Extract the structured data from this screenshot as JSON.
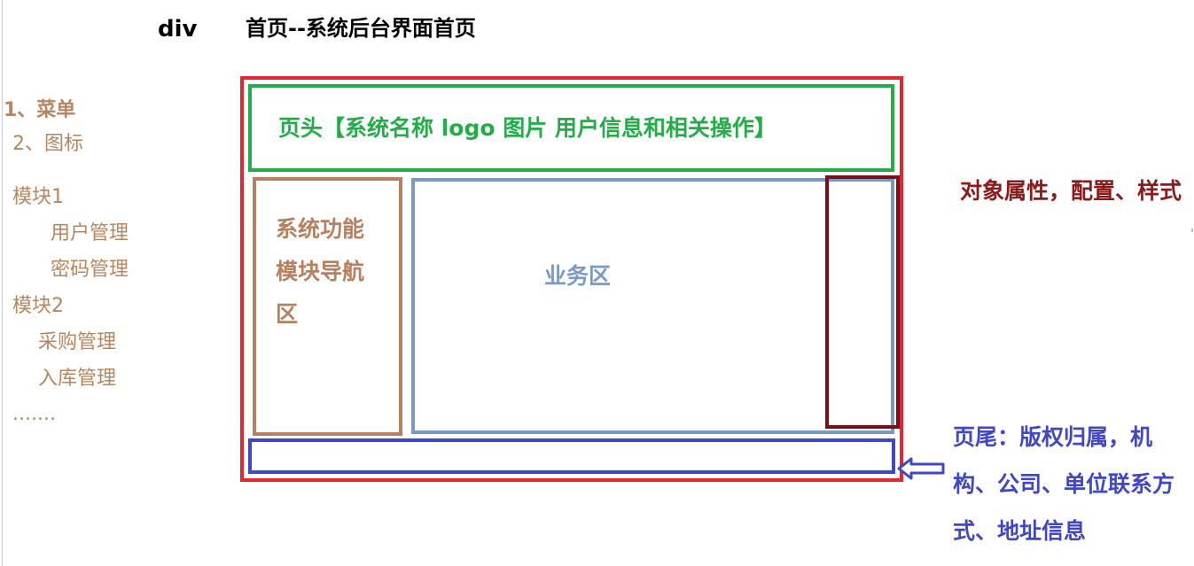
{
  "title": {
    "div_label": "div",
    "page_title": "首页--系统后台界面首页"
  },
  "menu": {
    "items": [
      {
        "label": "1、菜单",
        "bold": true
      },
      {
        "label": "2、图标",
        "bold": false
      },
      {
        "label": "模块1",
        "bold": false
      },
      {
        "label": "用户管理",
        "bold": false
      },
      {
        "label": "密码管理",
        "bold": false
      },
      {
        "label": "模块2",
        "bold": false
      },
      {
        "label": "采购管理",
        "bold": false
      },
      {
        "label": "入库管理",
        "bold": false
      },
      {
        "label": ".......",
        "bold": false
      }
    ]
  },
  "layout": {
    "header": "页头【系统名称  logo  图片  用户信息和相关操作】",
    "nav": "系统功能模块导航区",
    "business": "业务区",
    "attributes": "对象属性，配置、样式",
    "footer": "页尾：版权归属，机构、公司、单位联系方式、地址信息"
  },
  "colors": {
    "outer": "#e3262f",
    "header": "#22ad47",
    "nav": "#b8805e",
    "business": "#7a9ac3",
    "attributes": "#7a0f18",
    "footer": "#3f47c4",
    "menu": "#b8865e"
  }
}
